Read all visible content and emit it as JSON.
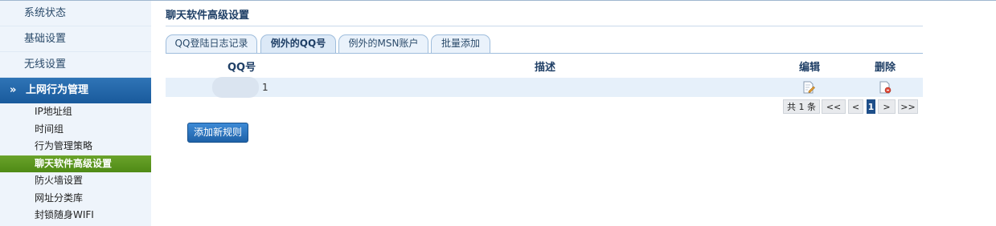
{
  "sidebar": {
    "items": [
      {
        "label": "系统状态"
      },
      {
        "label": "基础设置"
      },
      {
        "label": "无线设置"
      }
    ],
    "section": {
      "label": "上网行为管理",
      "chevron": "»"
    },
    "sub_items": [
      {
        "label": "IP地址组"
      },
      {
        "label": "时间组"
      },
      {
        "label": "行为管理策略"
      },
      {
        "label": "聊天软件高级设置"
      },
      {
        "label": "防火墙设置"
      },
      {
        "label": "网址分类库"
      },
      {
        "label": "封锁随身WIFI"
      }
    ]
  },
  "main": {
    "title": "聊天软件高级设置",
    "tabs": [
      {
        "label": "QQ登陆日志记录"
      },
      {
        "label": "例外的QQ号"
      },
      {
        "label": "例外的MSN账户"
      },
      {
        "label": "批量添加"
      }
    ],
    "table": {
      "headers": {
        "qq": "QQ号",
        "desc": "描述",
        "edit": "编辑",
        "delete": "删除"
      },
      "rows": [
        {
          "qq": "1",
          "desc": ""
        }
      ]
    },
    "pager": {
      "total": "共 1 条",
      "first": "<<",
      "prev": "<",
      "current": "1",
      "next": ">",
      "last": ">>"
    },
    "add_button": "添加新规则"
  },
  "colors": {
    "accent": "#1f62a8",
    "active_nav": "#5a9620",
    "header_text": "#1f3f66"
  },
  "icons": {
    "edit": "edit-icon",
    "delete": "delete-icon"
  }
}
